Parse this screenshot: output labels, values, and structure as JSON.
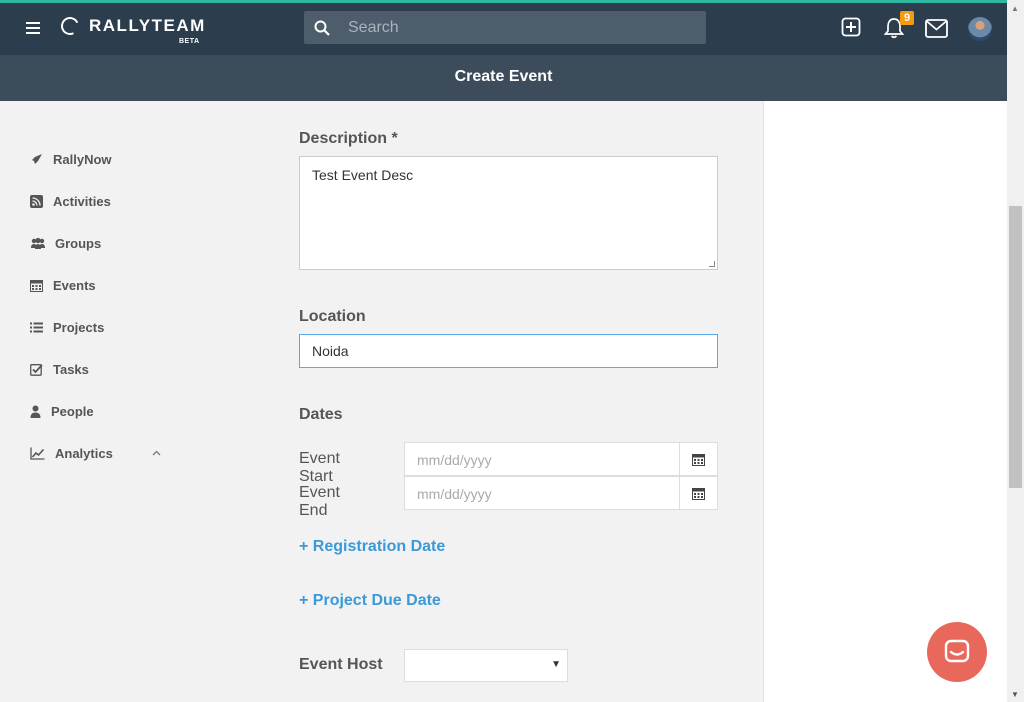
{
  "header": {
    "logo_text": "RALLYTEAM",
    "logo_badge": "BETA",
    "search_placeholder": "Search",
    "notification_count": "9",
    "icons": [
      "hamburger-icon",
      "search-icon",
      "add-icon",
      "bell-icon",
      "mail-icon",
      "avatar"
    ]
  },
  "page": {
    "title": "Create Event"
  },
  "sidebar": {
    "items": [
      {
        "label": "RallyNow",
        "icon": "rocket-icon"
      },
      {
        "label": "Activities",
        "icon": "rss-icon"
      },
      {
        "label": "Groups",
        "icon": "users-icon"
      },
      {
        "label": "Events",
        "icon": "calendar-icon"
      },
      {
        "label": "Projects",
        "icon": "list-icon"
      },
      {
        "label": "Tasks",
        "icon": "checkbox-icon"
      },
      {
        "label": "People",
        "icon": "user-icon"
      },
      {
        "label": "Analytics",
        "icon": "chart-icon"
      }
    ]
  },
  "form": {
    "description_label": "Description *",
    "description_value": "Test Event Desc",
    "location_label": "Location",
    "location_value": "Noida",
    "dates_label": "Dates",
    "event_start_label": "Event Start",
    "event_start_placeholder": "mm/dd/yyyy",
    "event_end_label": "Event End",
    "event_end_placeholder": "mm/dd/yyyy",
    "registration_link": "+ Registration Date",
    "project_due_link": "+ Project Due Date",
    "event_host_label": "Event Host",
    "event_host_value": ""
  },
  "colors": {
    "topbar": "#2c3e4e",
    "subheader": "#3d4c5a",
    "accent": "#2fb8a0",
    "link": "#3a9ad9",
    "badge": "#f39c12",
    "chat": "#e8695c"
  }
}
